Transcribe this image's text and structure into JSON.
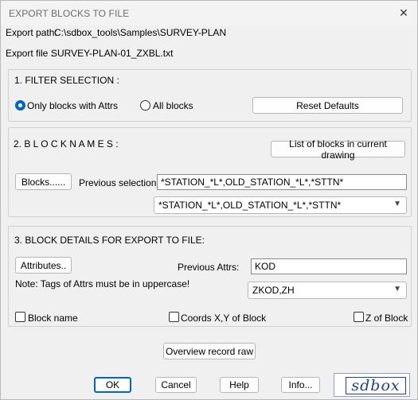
{
  "window": {
    "title": "EXPORT BLOCKS TO FILE",
    "close_glyph": "✕"
  },
  "export": {
    "path_label": "Export path:",
    "path_value": "C:\\sdbox_tools\\Samples\\SURVEY-PLAN",
    "file_label": "Export file :",
    "file_value": "SURVEY-PLAN-01_ZXBL.txt"
  },
  "filter": {
    "heading": "1.  FILTER SELECTION :",
    "radio_only_attrs": "Only blocks with Attrs",
    "radio_all": "All blocks",
    "selected": "Only blocks with Attrs",
    "reset_button": "Reset Defaults"
  },
  "block_names": {
    "heading": "2. B L O C K   N A M E S   :",
    "list_button": "List of blocks in current drawing",
    "blocks_button": "Blocks......",
    "previous_label": "Previous selection :",
    "previous_value": "*STATION_*L*,OLD_STATION_*L*,*STTN*",
    "combo_value": "*STATION_*L*,OLD_STATION_*L*,*STTN*"
  },
  "details": {
    "heading": "3.  BLOCK DETAILS FOR EXPORT TO FILE:",
    "attributes_button": "Attributes..",
    "previous_attrs_label": "Previous Attrs:",
    "previous_attrs_value": "KOD",
    "note": "Note: Tags of Attrs must be in uppercase!",
    "attrs_combo_value": "ZKOD,ZH",
    "check_block_name": "Block name",
    "check_coords": "Coords X,Y of Block",
    "check_z": "Z of Block",
    "checked": {
      "block_name": false,
      "coords": false,
      "z": false
    }
  },
  "overview_button": "Overview record raw",
  "footer": {
    "ok": "OK",
    "cancel": "Cancel",
    "help": "Help",
    "info": "Info..."
  },
  "logo_text": "sdbox",
  "icons": {
    "close": "close-icon",
    "chevron": "chevron-down-icon"
  },
  "colors": {
    "accent": "#0067c0",
    "logo": "#1f3f8f"
  }
}
